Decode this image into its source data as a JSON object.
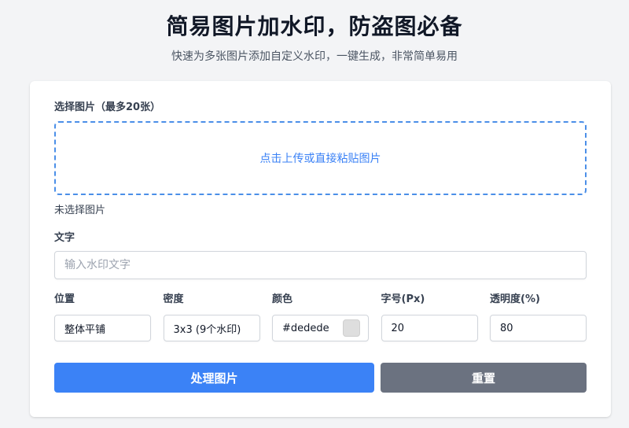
{
  "header": {
    "title": "简易图片加水印，防盗图必备",
    "subtitle": "快速为多张图片添加自定义水印，一键生成，非常简单易用"
  },
  "upload": {
    "label": "选择图片（最多20张）",
    "dropzone_text": "点击上传或直接粘贴图片",
    "status": "未选择图片"
  },
  "watermark_text": {
    "label": "文字",
    "placeholder": "输入水印文字",
    "value": ""
  },
  "options": {
    "position": {
      "label": "位置",
      "value": "整体平铺"
    },
    "density": {
      "label": "密度",
      "value": "3x3 (9个水印)"
    },
    "color": {
      "label": "颜色",
      "value": "#dedede",
      "swatch": "#dedede"
    },
    "font_size": {
      "label": "字号(Px)",
      "value": "20"
    },
    "opacity": {
      "label": "透明度(%)",
      "value": "80"
    }
  },
  "actions": {
    "process_label": "处理图片",
    "reset_label": "重置"
  },
  "colors": {
    "primary": "#3b82f6",
    "secondary": "#6b7280",
    "background": "#f3f4f6"
  }
}
